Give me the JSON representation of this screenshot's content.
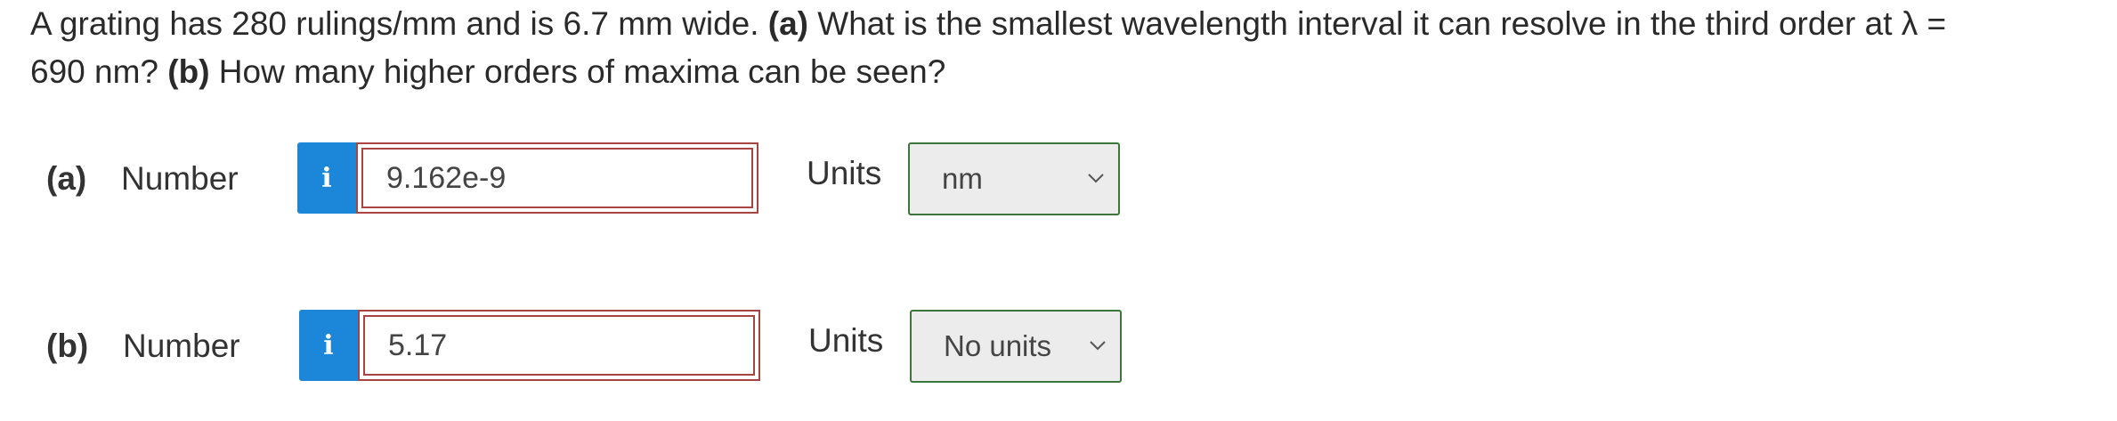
{
  "question": {
    "line1_pre": "A grating has 280 rulings/mm and is 6.7 mm wide. ",
    "part_a_marker": "(a)",
    "line1_post": " What is the smallest wavelength interval it can resolve in the third order at λ =",
    "line2_pre": "690 nm? ",
    "part_b_marker": "(b)",
    "line2_post": " How many higher orders of maxima can be seen?"
  },
  "parts": [
    {
      "label": "(a)",
      "number_label": "Number",
      "info_icon": "i",
      "answer_value": "9.162e-9",
      "units_label": "Units",
      "units_selected": "nm"
    },
    {
      "label": "(b)",
      "number_label": "Number",
      "info_icon": "i",
      "answer_value": "5.17",
      "units_label": "Units",
      "units_selected": "No units"
    }
  ],
  "colors": {
    "info_button": "#1c87d8",
    "answer_border_incorrect": "#a94442",
    "units_border": "#3c763d",
    "units_background": "#ececec"
  },
  "icons": {
    "info": "info-icon",
    "dropdown": "chevron-down-icon"
  }
}
